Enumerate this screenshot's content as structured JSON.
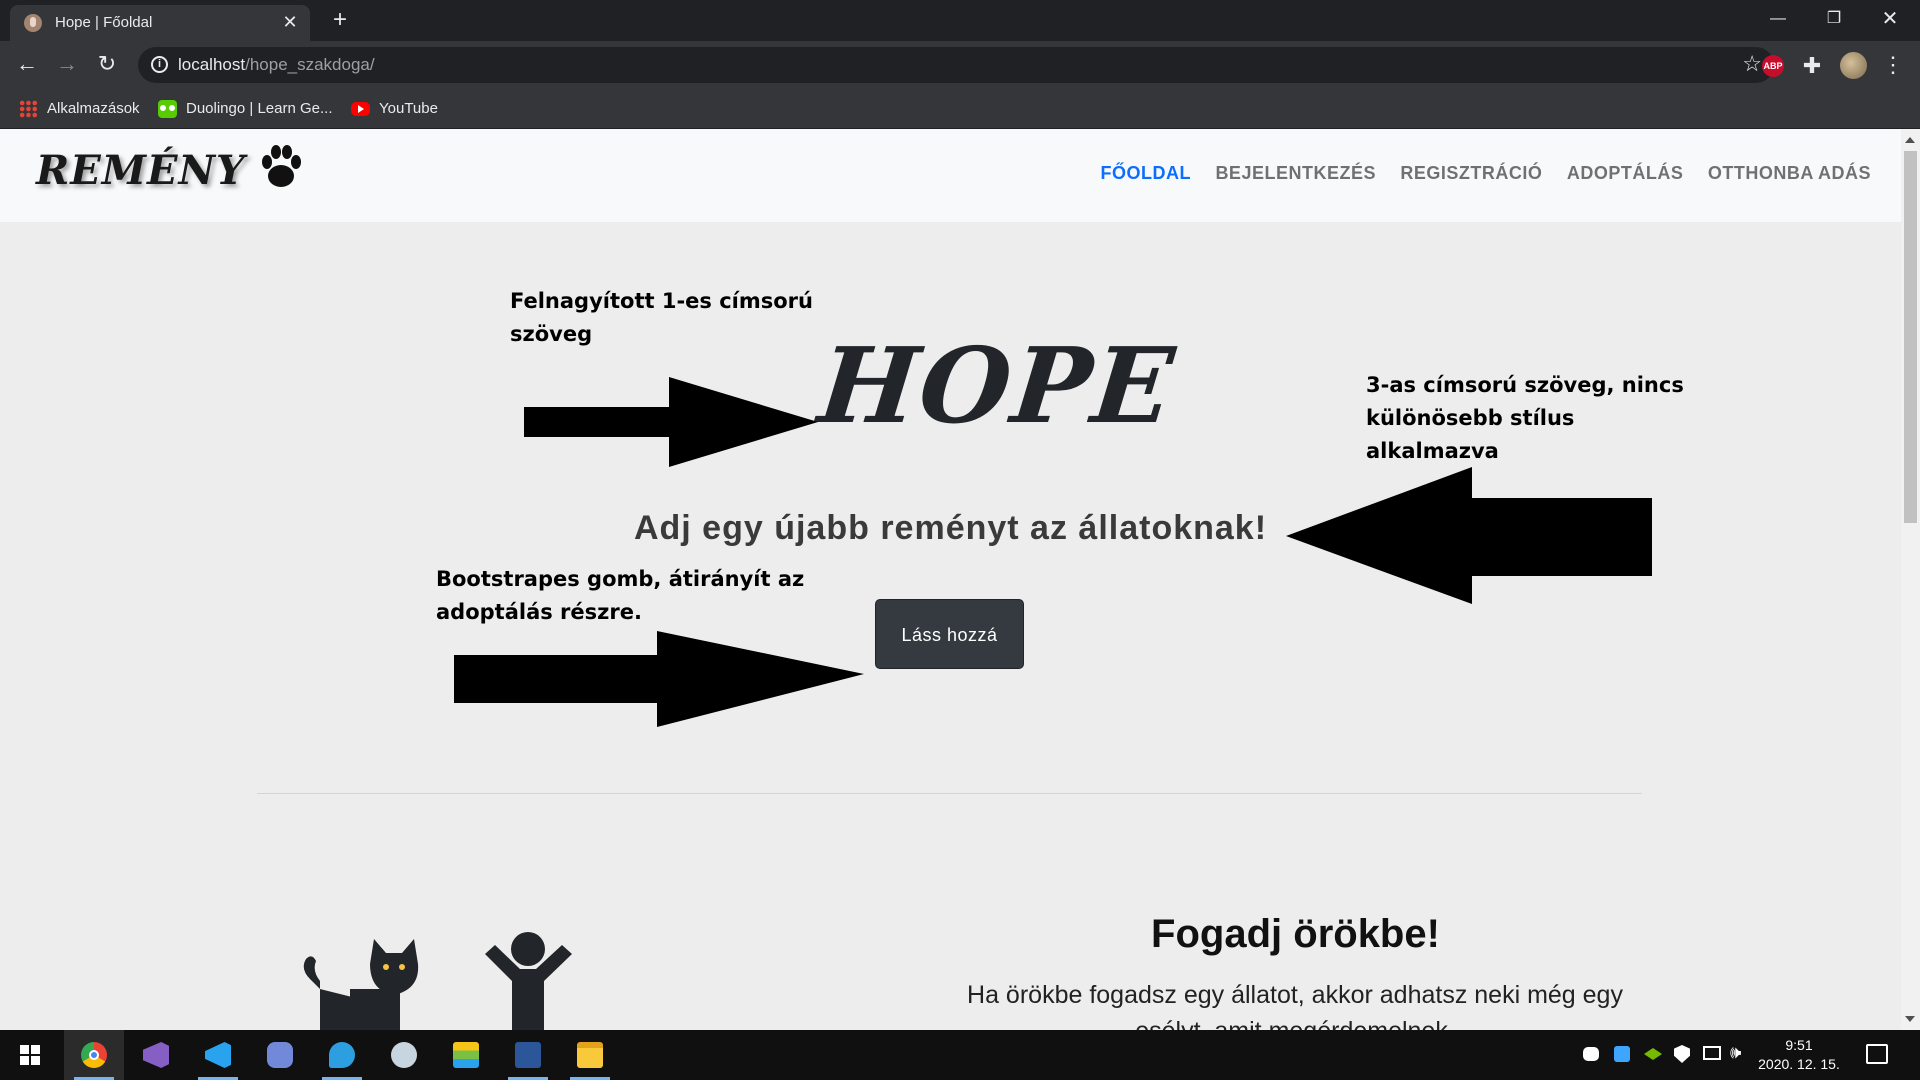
{
  "browser": {
    "tab_title": "Hope | Főoldal",
    "url_host": "localhost",
    "url_path": "/hope_szakdoga/",
    "bookmarks": [
      "Alkalmazások",
      "Duolingo | Learn Ge...",
      "YouTube"
    ],
    "abp_label": "ABP"
  },
  "site": {
    "brand": "REMÉNY",
    "nav": [
      "FŐOLDAL",
      "BEJELENTKEZÉS",
      "REGISZTRÁCIÓ",
      "ADOPTÁLÁS",
      "OTTHONBA ADÁS"
    ],
    "active_nav": "FŐOLDAL",
    "accent_color": "#0d6efd",
    "hero_title": "HOPE",
    "hero_subtitle": "Adj egy újabb reményt az állatoknak!",
    "hero_button": "Láss hozzá",
    "section_title": "Fogadj örökbe!",
    "section_text": "Ha örökbe fogadsz egy állatot, akkor adhatsz neki még egy esélyt, amit megérdemelnek."
  },
  "annotations": {
    "h1": "Felnagyított 1-es címsorú szöveg",
    "h3": "3-as címsorú szöveg, nincs különösebb stílus alkalmazva",
    "button": "Bootstrapes gomb, átirányít az adoptálás részre."
  },
  "taskbar": {
    "apps": [
      "windows-start",
      "chrome",
      "visual-studio",
      "vs-code",
      "discord",
      "edge",
      "steam",
      "bluestacks",
      "word",
      "file-explorer"
    ],
    "time": "9:51",
    "date": "2020. 12. 15."
  }
}
